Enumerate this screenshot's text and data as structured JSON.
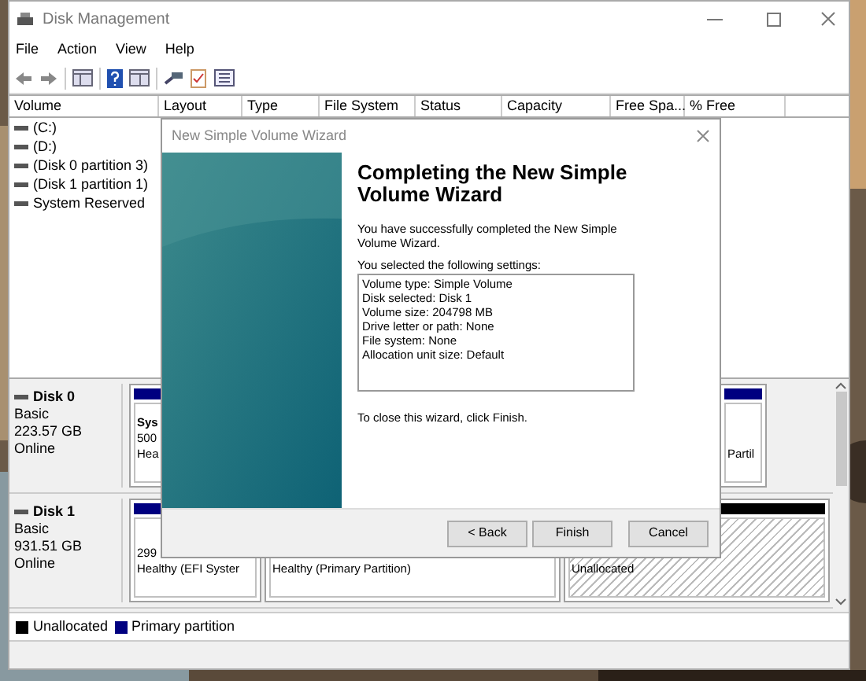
{
  "window": {
    "title": "Disk Management"
  },
  "menu": [
    "File",
    "Action",
    "View",
    "Help"
  ],
  "volume_table": {
    "columns": [
      "Volume",
      "Layout",
      "Type",
      "File System",
      "Status",
      "Capacity",
      "Free Spa...",
      "% Free"
    ],
    "rows": [
      "(C:)",
      "(D:)",
      "(Disk 0 partition 3)",
      "(Disk 1 partition 1)",
      "System Reserved"
    ]
  },
  "disks": [
    {
      "name": "Disk 0",
      "type": "Basic",
      "size": "223.57 GB",
      "status": "Online",
      "partitions": [
        {
          "kind": "primary",
          "lines": [
            "Sys",
            "500",
            "Hea"
          ]
        },
        {
          "kind": "primary",
          "lines": [
            "Partil"
          ]
        }
      ]
    },
    {
      "name": "Disk 1",
      "type": "Basic",
      "size": "931.51 GB",
      "status": "Online",
      "partitions": [
        {
          "kind": "primary",
          "lines": [
            "299",
            "Healthy (EFI Syster"
          ]
        },
        {
          "kind": "primary",
          "lines": [
            "Healthy (Primary Partition)"
          ]
        },
        {
          "kind": "unallocated",
          "lines": [
            "Unallocated"
          ]
        }
      ]
    }
  ],
  "legend": [
    {
      "label": "Unallocated",
      "color": "#000000"
    },
    {
      "label": "Primary partition",
      "color": "#000080"
    }
  ],
  "dialog": {
    "title": "New Simple Volume Wizard",
    "heading": "Completing the New Simple Volume Wizard",
    "intro": "You have successfully completed the New Simple Volume Wizard.",
    "settings_label": "You selected the following settings:",
    "settings": [
      "Volume type: Simple Volume",
      "Disk selected: Disk 1",
      "Volume size: 204798 MB",
      "Drive letter or path: None",
      "File system: None",
      "Allocation unit size: Default"
    ],
    "closing": "To close this wizard, click Finish.",
    "buttons": [
      "< Back",
      "Finish",
      "Cancel"
    ]
  }
}
